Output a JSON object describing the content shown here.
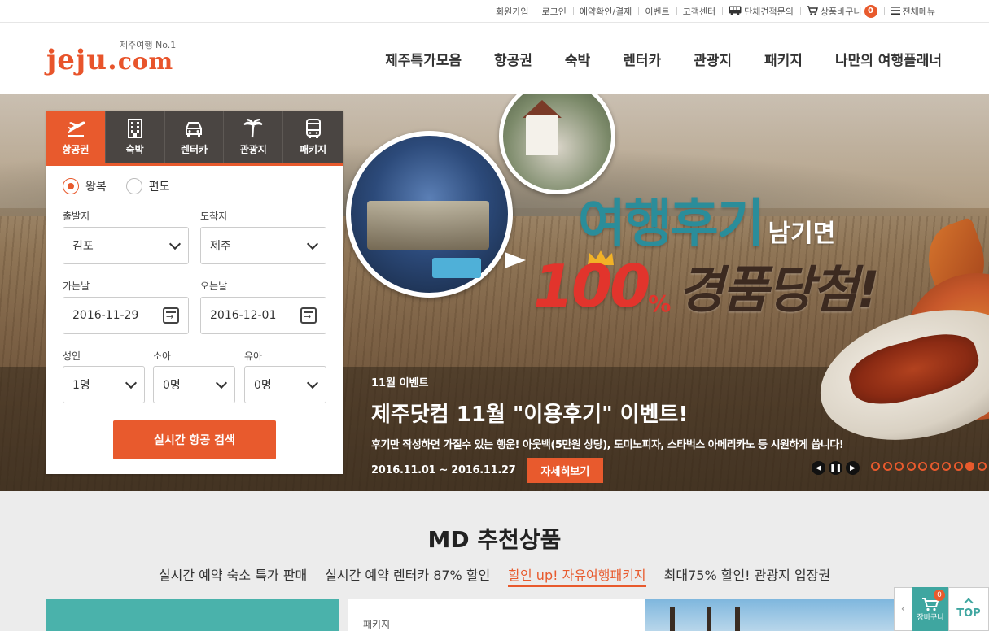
{
  "util": {
    "links": [
      "회원가입",
      "로그인",
      "예약확인/결제",
      "이벤트",
      "고객센터",
      "단체견적문의",
      "상품바구니",
      "전체메뉴"
    ],
    "cart_count": "0"
  },
  "logo": {
    "slogan": "제주여행 No.1",
    "word": "jeju",
    "dot": ".",
    "tld": "com"
  },
  "gnb": [
    "제주특가모음",
    "항공권",
    "숙박",
    "렌터카",
    "관광지",
    "패키지",
    "나만의 여행플래너"
  ],
  "search": {
    "tabs": [
      "항공권",
      "숙박",
      "렌터카",
      "관광지",
      "패키지"
    ],
    "active_tab": "항공권",
    "trip_types": [
      "왕복",
      "편도"
    ],
    "selected_trip": "왕복",
    "departure_label": "출발지",
    "departure_value": "김포",
    "arrival_label": "도착지",
    "arrival_value": "제주",
    "depart_date_label": "가는날",
    "depart_date": "2016-11-29",
    "return_date_label": "오는날",
    "return_date": "2016-12-01",
    "adult_label": "성인",
    "adult_value": "1명",
    "child_label": "소아",
    "child_value": "0명",
    "infant_label": "유아",
    "infant_value": "0명",
    "submit": "실시간 항공 검색"
  },
  "hero": {
    "headline_big": "여행후기",
    "headline_small": "남기면",
    "percent_num": "100",
    "percent_sym": "%",
    "prize": "경품당첨!",
    "event_tag": "11월 이벤트",
    "event_title": "제주닷컴 11월 \"이용후기\" 이벤트!",
    "event_desc": "후기만 작성하면 가질수 있는 행운! 아웃백(5만원 상당), 도미노피자, 스타벅스 아메리카노 등 시원하게 쏩니다!",
    "event_period": "2016.11.01 ~ 2016.11.27",
    "detail_button": "자세히보기",
    "slide_count": 10,
    "active_slide": 9
  },
  "md": {
    "title": "MD 추천상품",
    "tabs": [
      "실시간 예약 숙소 특가 판매",
      "실시간 예약 렌터카 87% 할인",
      "할인 up! 자유여행패키지",
      "최대75% 할인! 관광지 입장권"
    ],
    "active_tab": "할인 up! 자유여행패키지",
    "card_label": "패키지"
  },
  "float": {
    "cart_label": "장바구니",
    "cart_count": "0",
    "top_label": "TOP"
  },
  "colors": {
    "accent": "#e85a2d",
    "teal": "#3fa6a0",
    "tab_dark": "#4a4542"
  }
}
